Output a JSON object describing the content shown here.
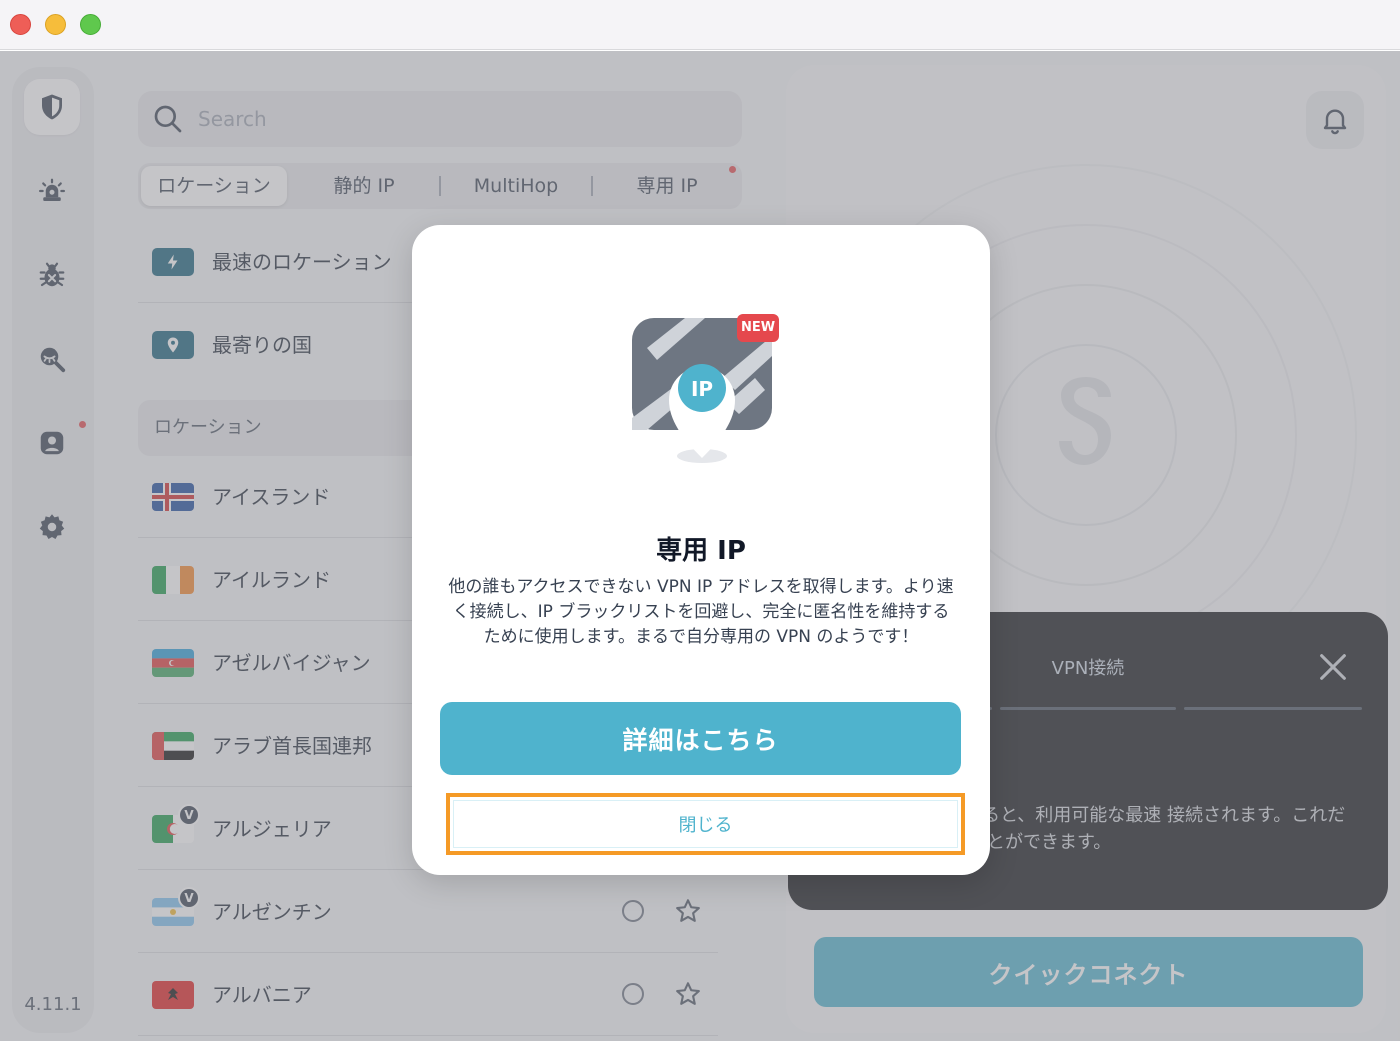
{
  "window": {
    "controls": [
      "close",
      "minimize",
      "maximize"
    ]
  },
  "sidebar": {
    "items": [
      {
        "icon": "shield-icon",
        "active": true
      },
      {
        "icon": "alert-icon",
        "active": false
      },
      {
        "icon": "bug-icon",
        "active": false
      },
      {
        "icon": "search-eye-icon",
        "active": false
      },
      {
        "icon": "account-icon",
        "active": false,
        "notification": true
      },
      {
        "icon": "gear-icon",
        "active": false
      }
    ],
    "version": "4.11.1"
  },
  "search": {
    "placeholder": "Search"
  },
  "tabs": [
    {
      "label": "ロケーション",
      "active": true
    },
    {
      "label": "静的 IP",
      "active": false
    },
    {
      "label": "MultiHop",
      "active": false
    },
    {
      "label": "専用 IP",
      "active": false,
      "notification": true
    }
  ],
  "quick_items": [
    {
      "label": "最速のロケーション",
      "icon": "bolt-icon"
    },
    {
      "label": "最寄りの国",
      "icon": "pin-icon"
    }
  ],
  "locations_header": "ロケーション",
  "locations": [
    {
      "name": "アイスランド",
      "flag": "iceland-flag-icon"
    },
    {
      "name": "アイルランド",
      "flag": "ireland-flag-icon"
    },
    {
      "name": "アゼルバイジャン",
      "flag": "azerbaijan-flag-icon"
    },
    {
      "name": "アラブ首長国連邦",
      "flag": "uae-flag-icon"
    },
    {
      "name": "アルジェリア",
      "flag": "algeria-flag-icon",
      "virtual_badge": "V"
    },
    {
      "name": "アルゼンチン",
      "flag": "argentina-flag-icon",
      "virtual_badge": "V"
    },
    {
      "name": "アルバニア",
      "flag": "albania-flag-icon"
    }
  ],
  "right_panel": {
    "bell_icon": "bell-icon",
    "tooltip": {
      "title": "VPN接続",
      "body": "ボタンをタップすると、利用可能な最速 接続されます。これだけで、即時に ることができます。"
    },
    "quick_connect_label": "クイックコネクト"
  },
  "modal": {
    "badge": "NEW",
    "illustration_label": "IP",
    "title": "専用 IP",
    "description": "他の誰もアクセスできない VPN IP アドレスを取得します。より速く接続し、IP ブラックリストを回避し、完全に匿名性を維持するために使用します。まるで自分専用の VPN のようです！",
    "primary_button": "詳細はこちら",
    "close_button": "閉じる"
  },
  "colors": {
    "accent": "#4fb3cd",
    "highlight_outline": "#f59a26",
    "badge_red": "#e5484d",
    "icon_dark": "#16607a"
  }
}
